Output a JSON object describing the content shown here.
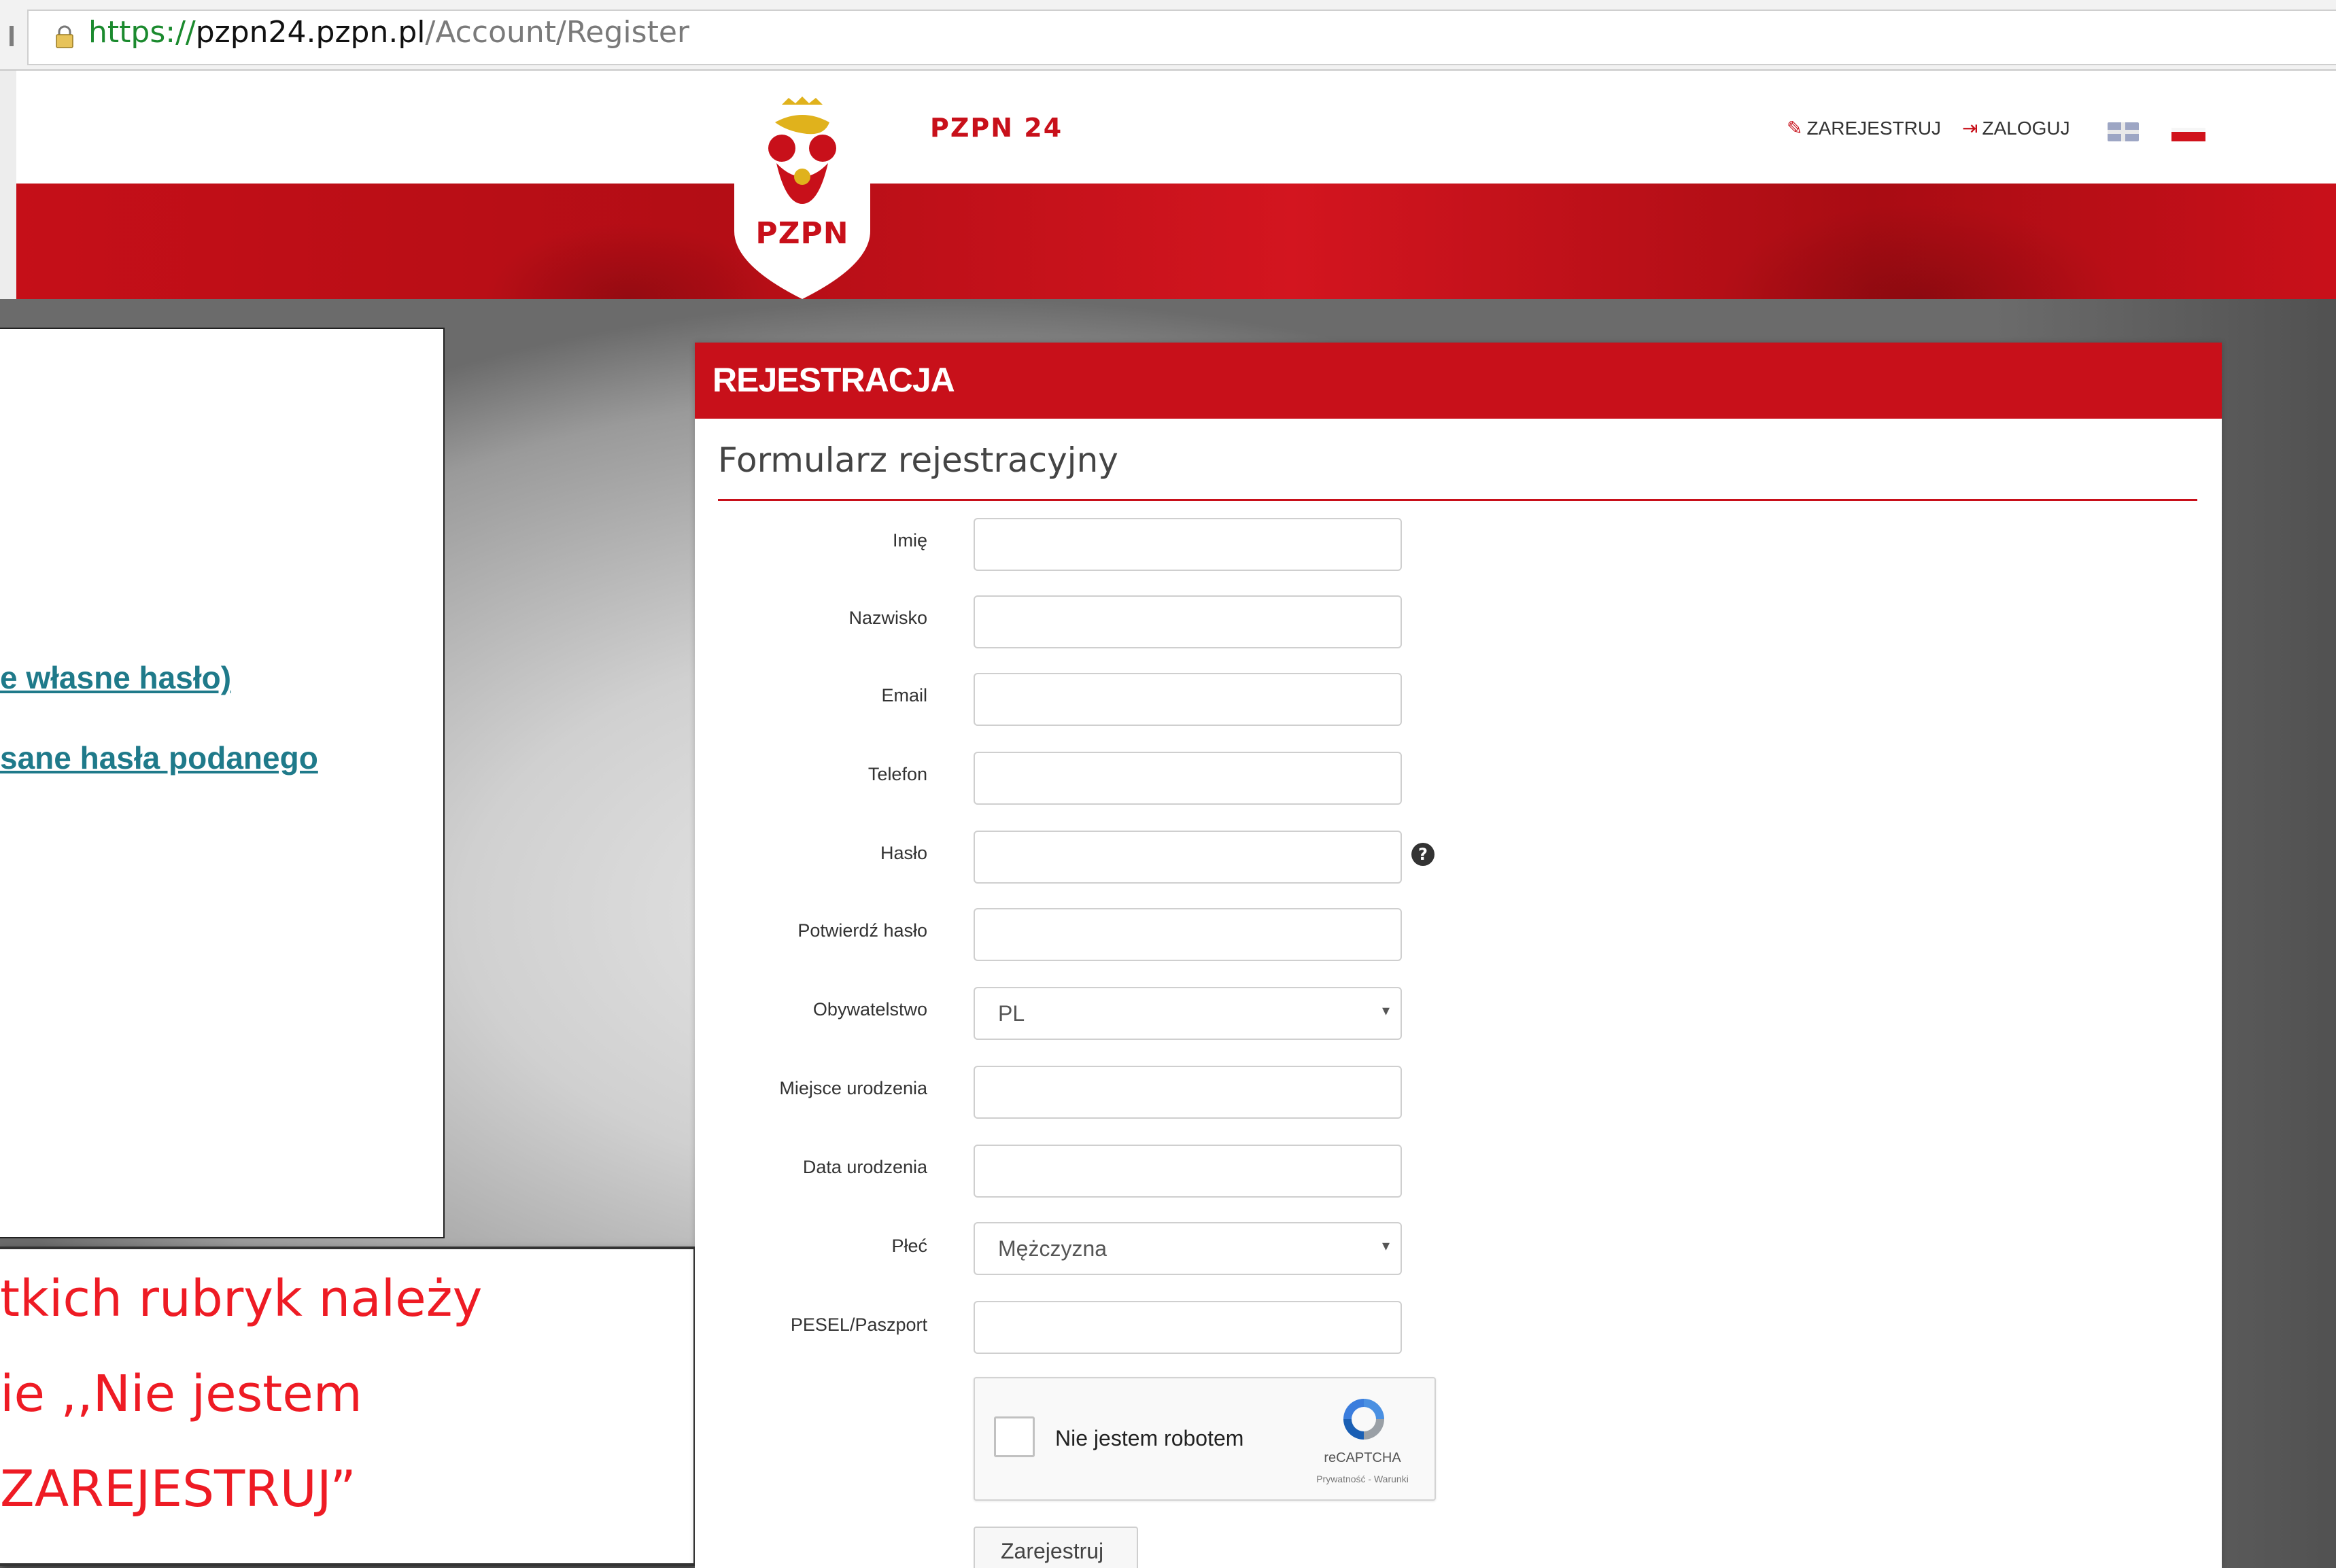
{
  "browser": {
    "url_scheme": "https://",
    "url_host": "pzpn24.pzpn.pl",
    "url_path": "/Account/Register"
  },
  "header": {
    "logo_text": "PZPN",
    "brand": "PZPN 24",
    "nav": {
      "register": "ZAREJESTRUJ",
      "login": "ZALOGUJ"
    },
    "flags": [
      "english-flag-icon",
      "polish-flag-icon"
    ]
  },
  "overlay": {
    "link1": "e własne hasło)",
    "link2": "sane hasła podanego",
    "note_lines": [
      "tkich rubryk należy",
      "ie ,,Nie jestem",
      "ZAREJESTRUJ”"
    ]
  },
  "card": {
    "title": "REJESTRACJA",
    "form_heading": "Formularz rejestracyjny"
  },
  "form": {
    "fields": [
      {
        "label": "Imię",
        "value": ""
      },
      {
        "label": "Nazwisko",
        "value": ""
      },
      {
        "label": "Email",
        "value": ""
      },
      {
        "label": "Telefon",
        "value": ""
      },
      {
        "label": "Hasło",
        "value": ""
      },
      {
        "label": "Potwierdź hasło",
        "value": ""
      },
      {
        "label": "Obywatelstwo",
        "value": "PL"
      },
      {
        "label": "Miejsce urodzenia",
        "value": ""
      },
      {
        "label": "Data urodzenia",
        "value": ""
      },
      {
        "label": "Płeć",
        "value": "Mężczyzna"
      },
      {
        "label": "PESEL/Paszport",
        "value": ""
      }
    ],
    "captcha": {
      "label": "Nie jestem robotem",
      "brand": "reCAPTCHA",
      "terms": "Prywatność - Warunki"
    },
    "submit": "Zarejestruj"
  },
  "colors": {
    "brand_red": "#c8101a",
    "link_teal": "#1f7a8a",
    "note_red": "#ee1b24"
  }
}
